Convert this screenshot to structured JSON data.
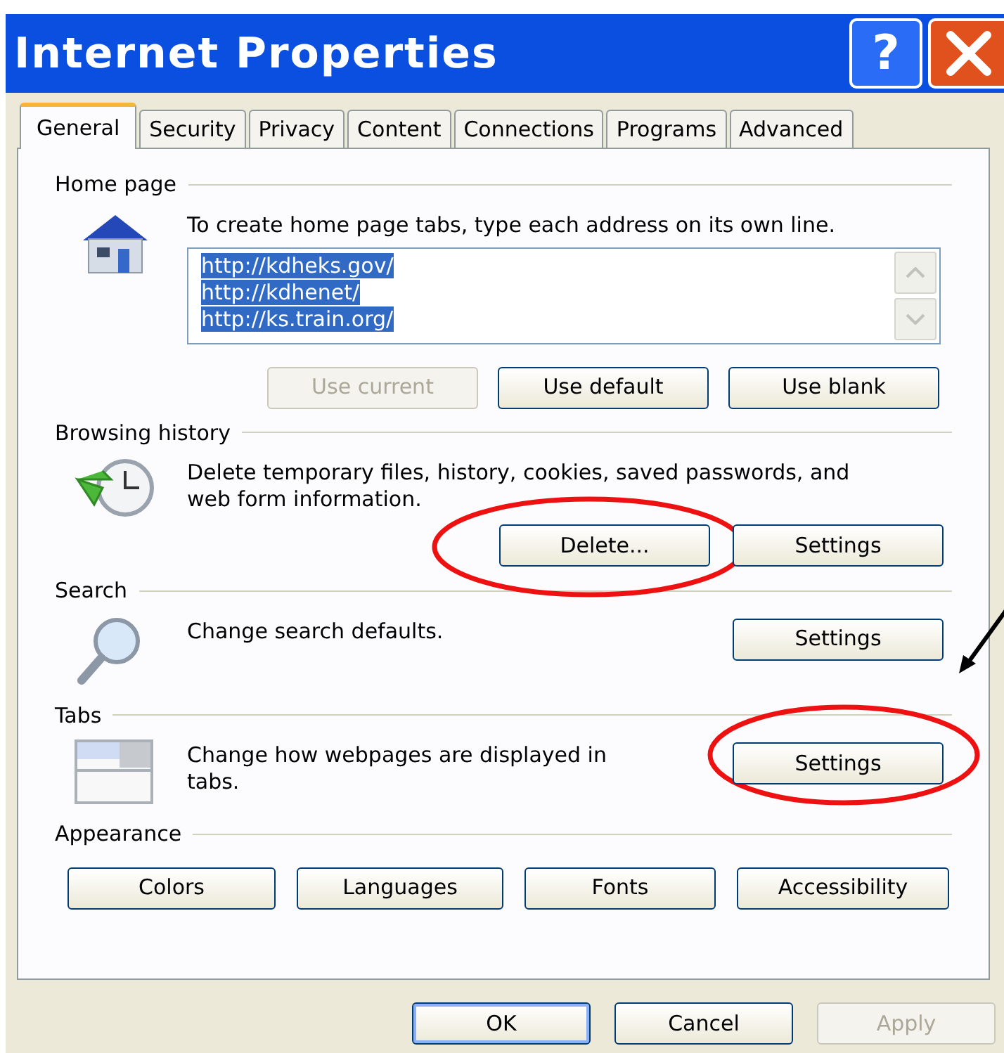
{
  "window": {
    "title": "Internet Properties",
    "help_label": "?"
  },
  "tabs": [
    {
      "label": "General",
      "selected": true
    },
    {
      "label": "Security",
      "selected": false
    },
    {
      "label": "Privacy",
      "selected": false
    },
    {
      "label": "Content",
      "selected": false
    },
    {
      "label": "Connections",
      "selected": false
    },
    {
      "label": "Programs",
      "selected": false
    },
    {
      "label": "Advanced",
      "selected": false
    }
  ],
  "sections": [
    {
      "kind": "home_page",
      "title": "Home page",
      "description": "To create home page tabs, type each address on its own line.",
      "home_pages": {
        "lines": [
          "http://kdheks.gov/",
          "http://kdhenet/",
          "http://ks.train.org/"
        ],
        "selected": true
      },
      "buttons": [
        {
          "label": "Use current",
          "disabled": true,
          "circled": false,
          "pointed_at": false
        },
        {
          "label": "Use default",
          "disabled": false,
          "circled": false,
          "pointed_at": false
        },
        {
          "label": "Use blank",
          "disabled": false,
          "circled": false,
          "pointed_at": false
        }
      ]
    },
    {
      "kind": "browsing_history",
      "title": "Browsing history",
      "description": "Delete temporary files, history, cookies, saved passwords, and web form information.",
      "buttons": [
        {
          "label": "Delete...",
          "disabled": false,
          "circled": true,
          "pointed_at": false
        },
        {
          "label": "Settings",
          "disabled": false,
          "circled": false,
          "pointed_at": false
        }
      ]
    },
    {
      "kind": "search",
      "title": "Search",
      "description": "Change search defaults.",
      "buttons": [
        {
          "label": "Settings",
          "disabled": false,
          "circled": false,
          "pointed_at": false
        }
      ]
    },
    {
      "kind": "tabs",
      "title": "Tabs",
      "description": "Change how webpages are displayed in tabs.",
      "buttons": [
        {
          "label": "Settings",
          "disabled": false,
          "circled": true,
          "pointed_at": true
        }
      ]
    },
    {
      "kind": "appearance",
      "title": "Appearance",
      "buttons": [
        {
          "label": "Colors",
          "disabled": false,
          "circled": false,
          "pointed_at": false
        },
        {
          "label": "Languages",
          "disabled": false,
          "circled": false,
          "pointed_at": false
        },
        {
          "label": "Fonts",
          "disabled": false,
          "circled": false,
          "pointed_at": false
        },
        {
          "label": "Accessibility",
          "disabled": false,
          "circled": false,
          "pointed_at": false
        }
      ]
    }
  ],
  "dialog_buttons": [
    {
      "label": "OK",
      "disabled": false,
      "default": true
    },
    {
      "label": "Cancel",
      "disabled": false,
      "default": false
    },
    {
      "label": "Apply",
      "disabled": true,
      "default": false
    }
  ]
}
